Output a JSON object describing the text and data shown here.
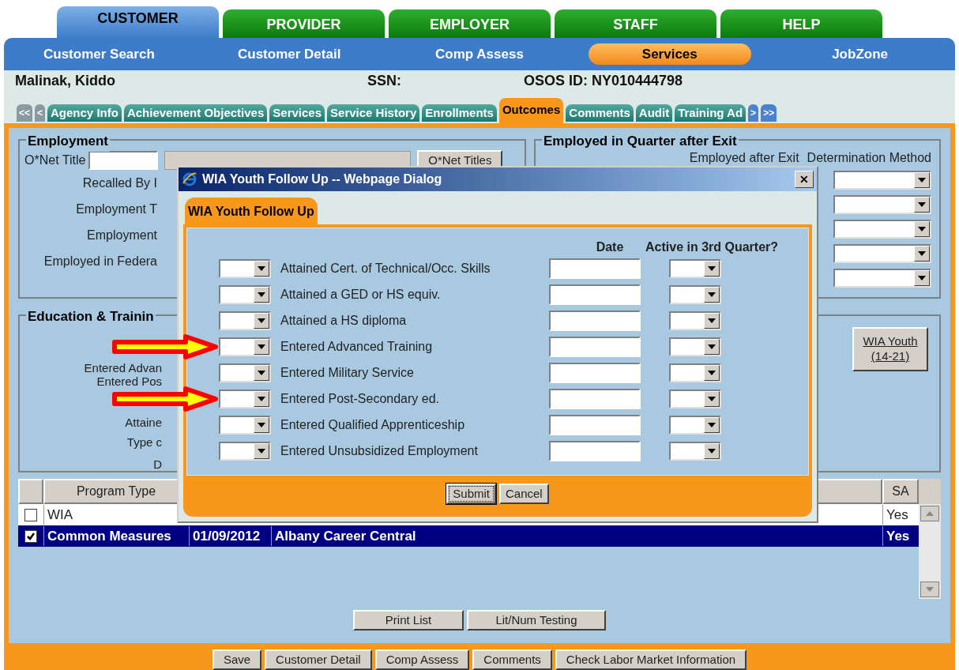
{
  "top_tabs": [
    {
      "label": "CUSTOMER",
      "selected": true
    },
    {
      "label": "PROVIDER",
      "selected": false
    },
    {
      "label": "EMPLOYER",
      "selected": false
    },
    {
      "label": "STAFF",
      "selected": false
    },
    {
      "label": "HELP",
      "selected": false
    }
  ],
  "nav": [
    {
      "label": "Customer Search",
      "selected": false
    },
    {
      "label": "Customer Detail",
      "selected": false
    },
    {
      "label": "Comp Assess",
      "selected": false
    },
    {
      "label": "Services",
      "selected": true
    },
    {
      "label": "JobZone",
      "selected": false
    }
  ],
  "customer": {
    "name": "Malinak, Kiddo",
    "ssn_label": "SSN:",
    "osos_id": "OSOS ID: NY010444798"
  },
  "sub_tabs": {
    "prev": [
      "<<",
      "<"
    ],
    "tabs": [
      {
        "label": "Agency Info",
        "selected": false
      },
      {
        "label": "Achievement Objectives",
        "selected": false
      },
      {
        "label": "Services",
        "selected": false
      },
      {
        "label": "Service History",
        "selected": false
      },
      {
        "label": "Enrollments",
        "selected": false
      },
      {
        "label": "Outcomes",
        "selected": true
      },
      {
        "label": "Comments",
        "selected": false
      },
      {
        "label": "Audit",
        "selected": false
      },
      {
        "label": "Training Ad",
        "selected": false
      }
    ],
    "next": [
      ">",
      ">>"
    ]
  },
  "employment": {
    "legend": "Employment",
    "onet_label": "O*Net Title",
    "onet_button": "O*Net Titles",
    "labels": [
      "Recalled By I",
      "Employment T",
      "Employment",
      "Employed in Federa"
    ]
  },
  "quarter": {
    "legend": "Employed in Quarter after Exit",
    "column_1": "Employed after Exit",
    "column_2": "Determination Method"
  },
  "education": {
    "legend": "Education & Trainin",
    "labels": [
      "Entered Advan",
      "Entered Pos",
      "Attaine",
      "Type c",
      "D"
    ],
    "wia_button": [
      "WIA Youth",
      "(14-21)"
    ]
  },
  "table": {
    "columns": [
      "Program Type",
      "SA"
    ],
    "rows": [
      {
        "program_type": "WIA",
        "sa": "Yes",
        "checked": false,
        "selected": false
      },
      {
        "program_type": "Common Measures",
        "date": "01/09/2012",
        "office": "Albany Career Central",
        "sa": "Yes",
        "checked": true,
        "selected": true
      }
    ]
  },
  "list_buttons": [
    "Print List",
    "Lit/Num Testing"
  ],
  "footer_buttons": [
    "Save",
    "Customer Detail",
    "Comp Assess",
    "Comments",
    "Check Labor Market Information"
  ],
  "dialog": {
    "title": "WIA Youth Follow Up -- Webpage Dialog",
    "close": "✕",
    "tab": "WIA Youth Follow Up",
    "date_header": "Date",
    "active_header": "Active in 3rd Quarter?",
    "rows": [
      {
        "label": "Attained Cert. of Technical/Occ. Skills",
        "arrow": false
      },
      {
        "label": "Attained a GED or HS equiv.",
        "arrow": false
      },
      {
        "label": "Attained a HS diploma",
        "arrow": false
      },
      {
        "label": "Entered Advanced Training",
        "arrow": true
      },
      {
        "label": "Entered Military Service",
        "arrow": false
      },
      {
        "label": "Entered Post-Secondary ed.",
        "arrow": true
      },
      {
        "label": "Entered Qualified Apprenticeship",
        "arrow": false
      },
      {
        "label": "Entered Unsubsidized Employment",
        "arrow": false
      }
    ],
    "buttons": [
      {
        "label": "Submit",
        "focused": true
      },
      {
        "label": "Cancel",
        "focused": false
      }
    ]
  }
}
